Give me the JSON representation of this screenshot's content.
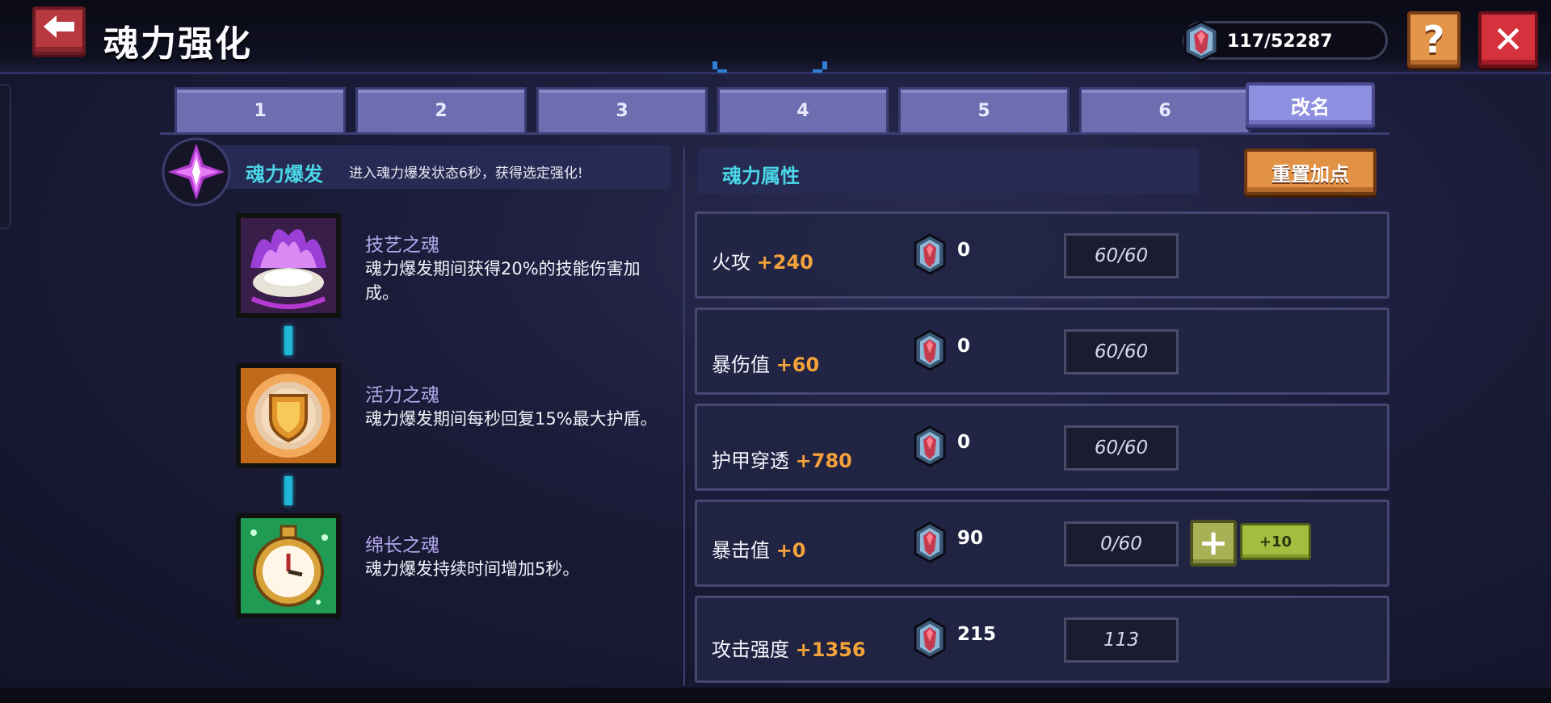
{
  "header": {
    "title": "魂力强化",
    "currency_amount": "117/52287",
    "help_label": "?",
    "close_label": "✕",
    "back_label": "🡐"
  },
  "tabs": [
    "1",
    "2",
    "3",
    "4",
    "5",
    "6"
  ],
  "rename_label": "改名",
  "burst": {
    "title": "魂力爆发",
    "description": "进入魂力爆发状态6秒，获得选定强化!"
  },
  "skills": [
    {
      "name": "技艺之魂",
      "description": "魂力爆发期间获得20%的技能伤害加成。",
      "icon": "purple-flame-icon"
    },
    {
      "name": "活力之魂",
      "description": "魂力爆发期间每秒回复15%最大护盾。",
      "icon": "golden-shield-icon"
    },
    {
      "name": "绵长之魂",
      "description": "魂力爆发持续时间增加5秒。",
      "icon": "stopwatch-icon"
    }
  ],
  "attributes": {
    "title": "魂力属性",
    "reset_label": "重置加点",
    "plus_label": "+",
    "plus10_label": "+10",
    "rows": [
      {
        "name": "火攻",
        "bonus": "+240",
        "cost": "0",
        "level": "60/60"
      },
      {
        "name": "暴伤值",
        "bonus": "+60",
        "cost": "0",
        "level": "60/60"
      },
      {
        "name": "护甲穿透",
        "bonus": "+780",
        "cost": "0",
        "level": "60/60"
      },
      {
        "name": "暴击值",
        "bonus": "+0",
        "cost": "90",
        "level": "0/60"
      },
      {
        "name": "攻击强度",
        "bonus": "+1356",
        "cost": "215",
        "level": "113"
      }
    ]
  },
  "colors": {
    "accent_cyan": "#4ad6e7",
    "bonus_orange": "#f4a23a",
    "tab_purple": "#6d6eb0",
    "close_red": "#d6323d",
    "help_orange": "#e3964a"
  }
}
